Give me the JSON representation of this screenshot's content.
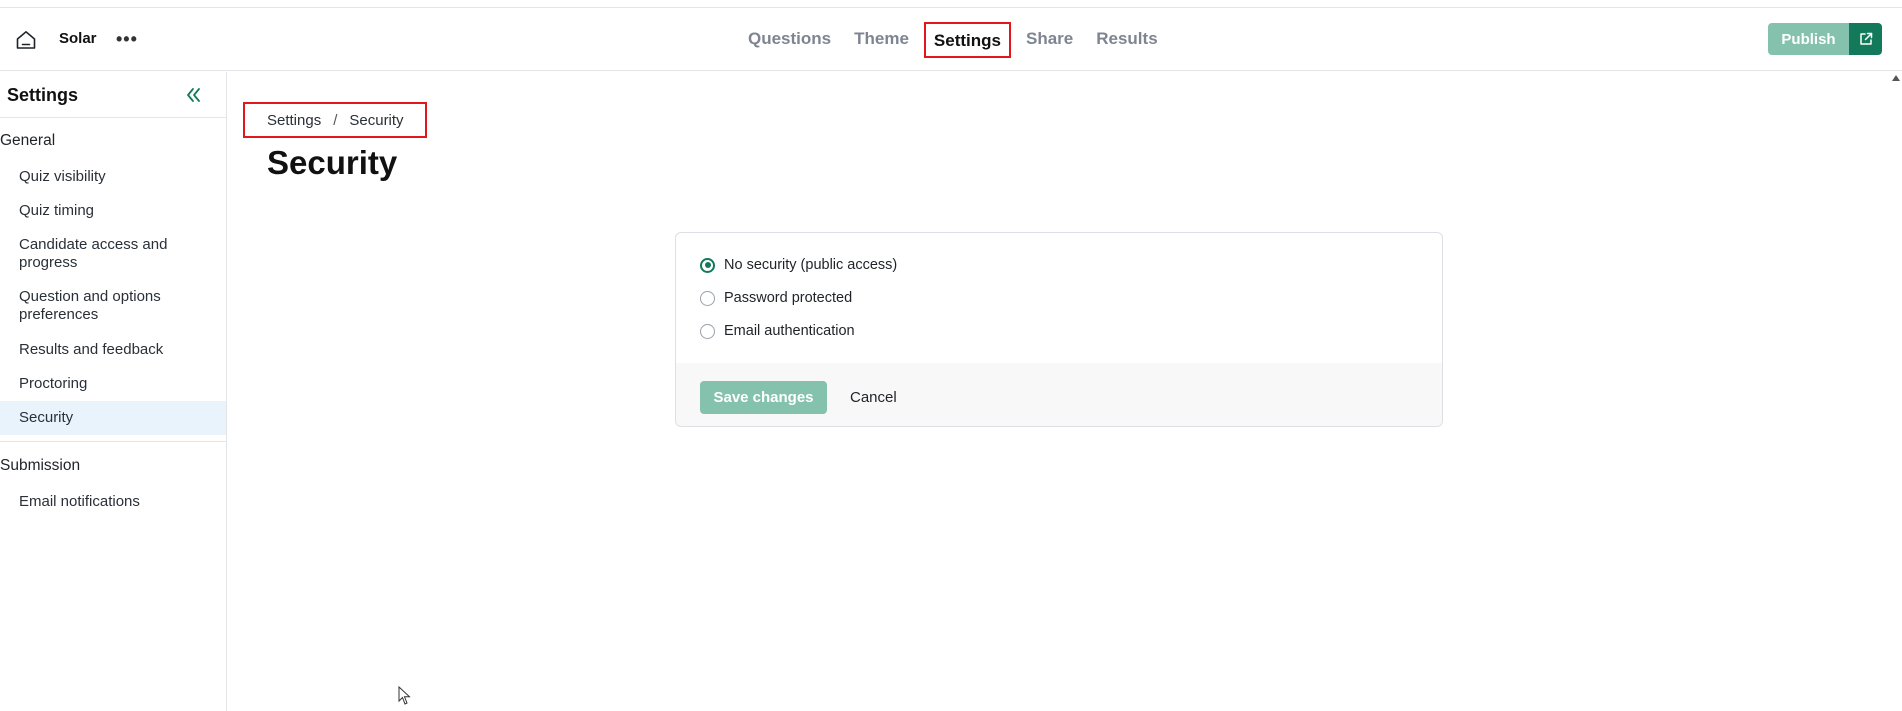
{
  "header": {
    "app_name": "Solar",
    "more_label": "•••",
    "tabs": [
      {
        "label": "Questions"
      },
      {
        "label": "Theme"
      },
      {
        "label": "Settings"
      },
      {
        "label": "Share"
      },
      {
        "label": "Results"
      }
    ],
    "active_tab": "Settings",
    "publish_label": "Publish"
  },
  "sidebar": {
    "title": "Settings",
    "groups": [
      {
        "title": "General",
        "items": [
          {
            "label": "Quiz visibility"
          },
          {
            "label": "Quiz timing"
          },
          {
            "label": "Candidate access and progress"
          },
          {
            "label": "Question and options preferences"
          },
          {
            "label": "Results and feedback"
          },
          {
            "label": "Proctoring"
          },
          {
            "label": "Security"
          }
        ]
      },
      {
        "title": "Submission",
        "items": [
          {
            "label": "Email notifications"
          }
        ]
      }
    ],
    "active_item": "Security"
  },
  "main": {
    "breadcrumb": [
      "Settings",
      "Security"
    ],
    "breadcrumb_separator": "/",
    "title": "Security",
    "options": [
      {
        "label": "No security (public access)",
        "checked": true
      },
      {
        "label": "Password protected",
        "checked": false
      },
      {
        "label": "Email authentication",
        "checked": false
      }
    ],
    "save_label": "Save changes",
    "cancel_label": "Cancel"
  },
  "colors": {
    "accent": "#127a5b",
    "accent_light": "#85c2ad",
    "highlight_border": "#e2161d",
    "active_bg": "#e8f3fc"
  }
}
